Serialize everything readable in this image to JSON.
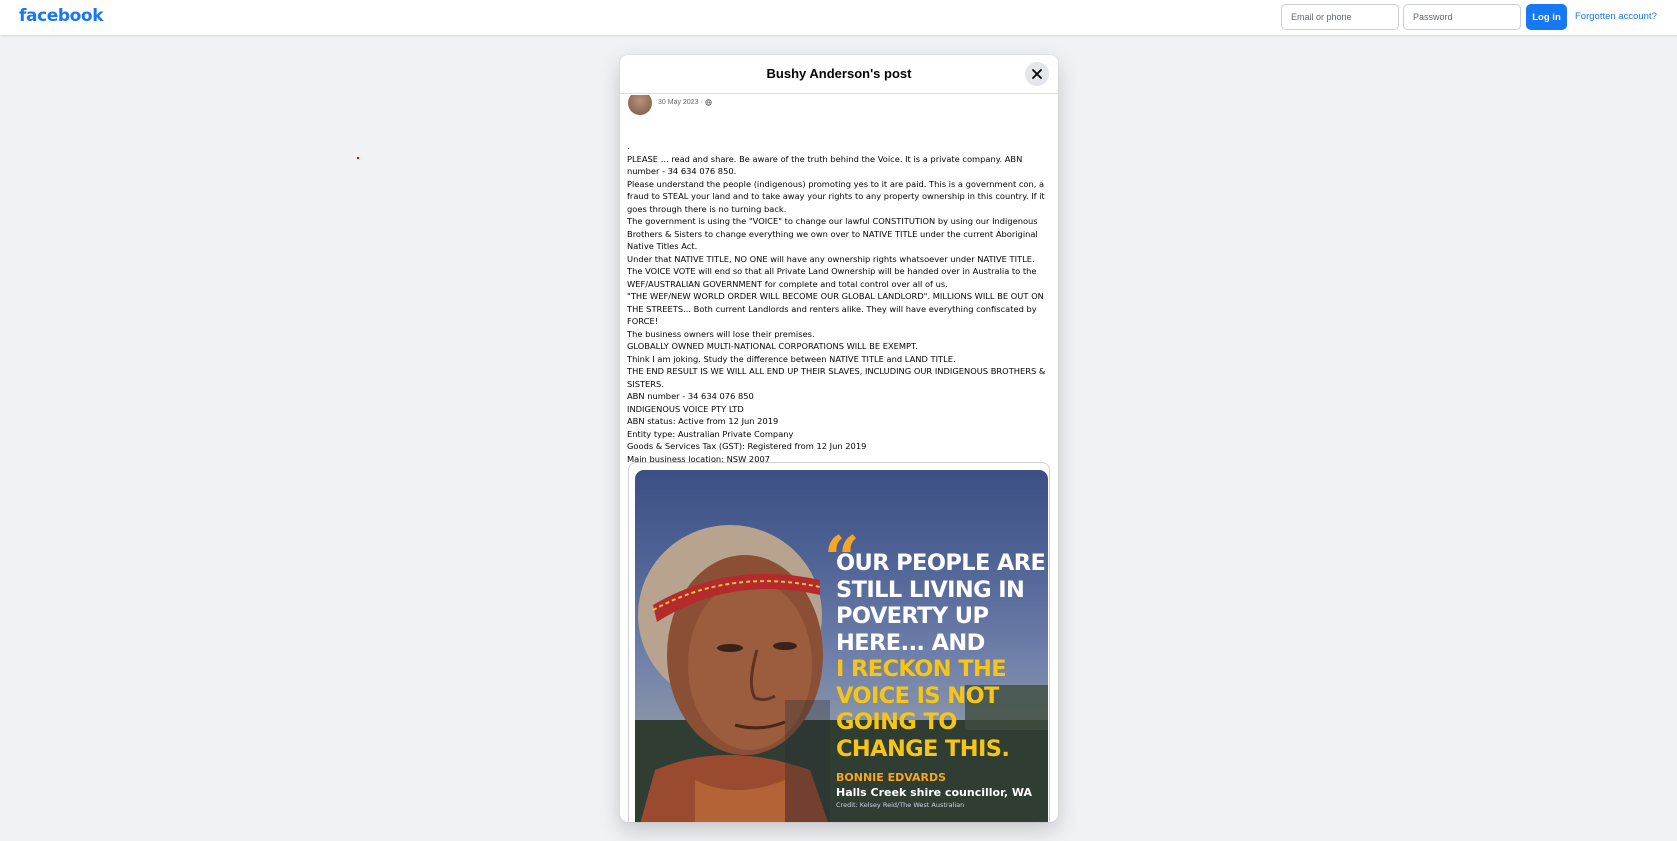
{
  "header": {
    "logo": "facebook",
    "email_placeholder": "Email or phone",
    "password_placeholder": "Password",
    "login_label": "Log in",
    "forgot_label": "Forgotten account?"
  },
  "modal": {
    "title": "Bushy Anderson's post",
    "post_date": "30 May 2023 ·",
    "post_lines": [
      ".",
      "PLEASE ... read and share. Be aware of the truth behind the Voice. It is a private company. ABN number - 34 634 076 850.",
      "Please understand the people (indigenous) promoting yes to it are paid. This is a government con, a fraud to STEAL your land and to take away your rights to any property ownership in this country. If it goes through there is no turning back.",
      "The government is using the \"VOICE\" to change our lawful CONSTITUTION by using our Indigenous Brothers & Sisters to change everything we own over to NATIVE TITLE under the current Aboriginal Native Titles Act.",
      "Under that NATIVE TITLE, NO ONE will have any ownership rights whatsoever under NATIVE TITLE.",
      "The VOICE VOTE will end so that all Private Land Ownership will be handed over in Australia to the WEF/AUSTRALIAN GOVERNMENT for complete and total control over all of us.",
      "\"THE WEF/NEW WORLD ORDER WILL BECOME OUR GLOBAL LANDLORD\". MILLIONS WILL BE OUT ON THE STREETS... Both current Landlords and renters alike. They will have everything confiscated by FORCE!",
      "The business owners will lose their premises.",
      "GLOBALLY OWNED MULTI-NATIONAL CORPORATIONS WILL BE EXEMPT.",
      "Think I am joking. Study the difference between NATIVE TITLE and LAND TITLE.",
      "THE END RESULT IS WE WILL ALL END UP THEIR SLAVES, INCLUDING OUR INDIGENOUS BROTHERS & SISTERS.",
      "ABN number - 34 634 076 850",
      "INDIGENOUS VOICE PTY LTD",
      "ABN status: Active from 12 Jun 2019",
      "Entity type: Australian Private Company",
      "Goods & Services Tax (GST): Registered from 12 Jun 2019",
      "Main business location: NSW 2007"
    ],
    "image": {
      "quote_mark": "“",
      "quote_white": "OUR PEOPLE ARE STILL LIVING IN POVERTY UP HERE... AND",
      "quote_yellow": "I RECKON THE VOICE IS NOT GOING TO CHANGE THIS.",
      "attribution_name": "BONNIE EDVARDS",
      "attribution_role": "Halls Creek shire councillor, WA",
      "attribution_credit": "Credit: Kelsey Reid/The West Australian"
    }
  },
  "colors": {
    "brand": "#1877f2",
    "page_bg": "#f0f2f5",
    "quote_yellow": "#f5c518",
    "quote_orange": "#f5a623"
  },
  "icons": {
    "close": "close-icon",
    "globe": "globe-icon"
  }
}
